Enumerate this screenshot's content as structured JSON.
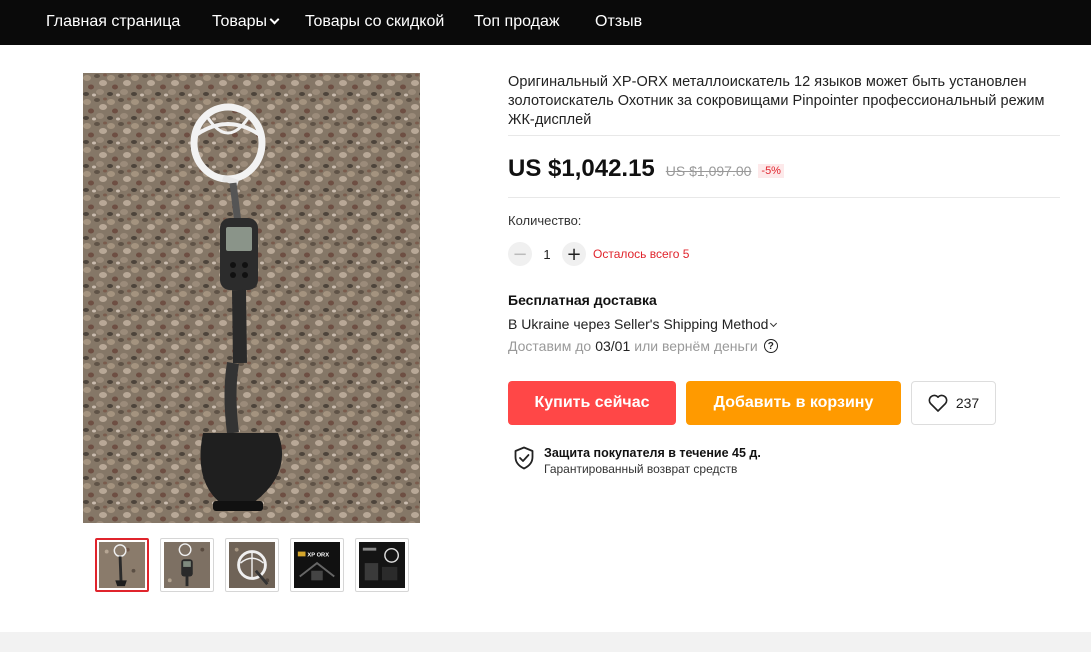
{
  "nav": {
    "items": [
      {
        "label": "Главная страница"
      },
      {
        "label": "Товары",
        "dropdown": true
      },
      {
        "label": "Товары со скидкой"
      },
      {
        "label": "Топ продаж"
      },
      {
        "label": "Отзыв"
      }
    ]
  },
  "product": {
    "title": "Оригинальный XP-ORX металлоискатель 12 языков может быть установлен золотоискатель Охотник за сокровищами Pinpointer профессиональный режим ЖК-дисплей",
    "price": "US $1,042.15",
    "old_price": "US $1,097.00",
    "discount": "-5%",
    "main_image_icon": "metal-detector-photo",
    "thumbnails": [
      {
        "icon": "detector-on-gravel-thumb",
        "active": true
      },
      {
        "icon": "detector-control-box-thumb",
        "active": false
      },
      {
        "icon": "detector-coil-thumb",
        "active": false
      },
      {
        "icon": "xp-orx-box-thumb",
        "active": false,
        "text": "XP ORX"
      },
      {
        "icon": "detector-package-thumb",
        "active": false
      }
    ]
  },
  "quantity": {
    "label": "Количество:",
    "minus": "−",
    "value": "1",
    "plus": "+",
    "stock": "Осталось всего 5"
  },
  "shipping": {
    "title": "Бесплатная доставка",
    "method": "В Ukraine через Seller's Shipping Method",
    "delivery_prefix": "Доставим до",
    "delivery_date": "03/01",
    "delivery_suffix": "или вернём деньги",
    "help_icon": "question-circle-icon"
  },
  "actions": {
    "buy_label": "Купить сейчас",
    "cart_label": "Добавить в корзину",
    "wish_count": "237",
    "wish_icon": "heart-icon"
  },
  "protection": {
    "icon": "shield-check-icon",
    "title": "Защита покупателя в течение 45 д.",
    "subtitle": "Гарантированный возврат средств"
  },
  "colors": {
    "nav_bg": "#0a0a0a",
    "buy": "#ff4747",
    "cart": "#ff9a00",
    "accent_red": "#e0242c"
  }
}
